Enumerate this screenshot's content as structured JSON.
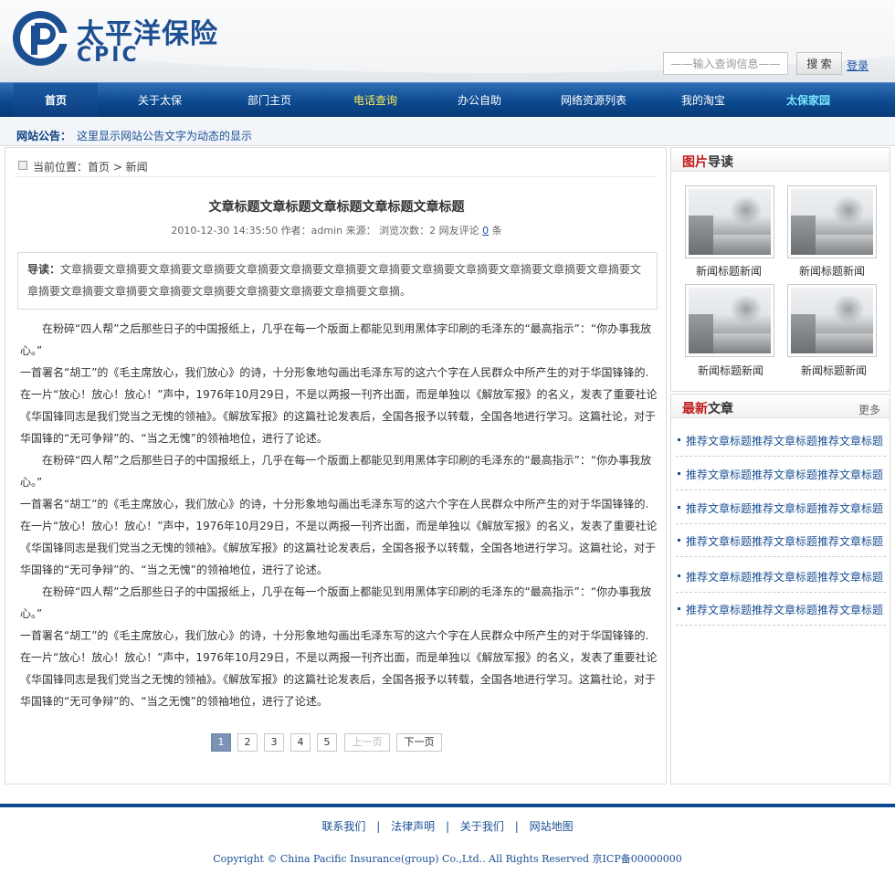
{
  "brand": {
    "name_cn": "太平洋保险",
    "name_en": "CPIC",
    "color": "#1d4f93"
  },
  "search": {
    "placeholder": "——输入查询信息——",
    "button": "搜 索",
    "login": "登录"
  },
  "nav": {
    "items": [
      {
        "label": "首页",
        "style": "active"
      },
      {
        "label": "关于太保",
        "style": ""
      },
      {
        "label": "部门主页",
        "style": ""
      },
      {
        "label": "电话查询",
        "style": "hl-yellow"
      },
      {
        "label": "办公自助",
        "style": ""
      },
      {
        "label": "网络资源列表",
        "style": ""
      },
      {
        "label": "我的淘宝",
        "style": ""
      },
      {
        "label": "太保家园",
        "style": "hl-cyan"
      }
    ]
  },
  "notice": {
    "label": "网站公告：",
    "text": "这里显示网站公告文字为动态的显示"
  },
  "breadcrumb": {
    "text": "当前位置：首页 > 新闻"
  },
  "article": {
    "title": "文章标题文章标题文章标题文章标题文章标题",
    "meta_prefix": "2010-12-30 14:35:50 作者：admin 来源： 浏览次数：2 网友评论",
    "comment_count": "0",
    "meta_suffix": "条",
    "abstract_label": "导读：",
    "abstract_text": "文章摘要文章摘要文章摘要文章摘要文章摘要文章摘要文章摘要文章摘要文章摘要文章摘要文章摘要文章摘要文章摘要文章摘要文章摘要文章摘要文章摘要文章摘要文章摘要文章摘要文章摘要文章摘。",
    "paragraphs": [
      {
        "text": "在粉碎“四人帮”之后那些日子的中国报纸上，几乎在每一个版面上都能见到用黑体字印刷的毛泽东的“最高指示”：“你办事我放心。”",
        "indent": true
      },
      {
        "text": "一首署名“胡工”的《毛主席放心，我们放心》的诗，十分形象地勾画出毛泽东写的这六个字在人民群众中所产生的对于华国锋锋的.在一片“放心！放心！放心！”声中，1976年10月29日，不是以两报一刊齐出面，而是单独以《解放军报》的名义，发表了重要社论《华国锋同志是我们党当之无愧的领袖》。《解放军报》的这篇社论发表后，全国各报予以转载，全国各地进行学习。这篇社论，对于华国锋的“无可争辩”的、“当之无愧”的领袖地位，进行了论述。",
        "indent": false
      },
      {
        "text": "在粉碎“四人帮”之后那些日子的中国报纸上，几乎在每一个版面上都能见到用黑体字印刷的毛泽东的“最高指示”：“你办事我放心。”",
        "indent": true
      },
      {
        "text": "一首署名“胡工”的《毛主席放心，我们放心》的诗，十分形象地勾画出毛泽东写的这六个字在人民群众中所产生的对于华国锋锋的.在一片“放心！放心！放心！”声中，1976年10月29日，不是以两报一刊齐出面，而是单独以《解放军报》的名义，发表了重要社论《华国锋同志是我们党当之无愧的领袖》。《解放军报》的这篇社论发表后，全国各报予以转载，全国各地进行学习。这篇社论，对于华国锋的“无可争辩”的、“当之无愧”的领袖地位，进行了论述。",
        "indent": false
      },
      {
        "text": "在粉碎“四人帮”之后那些日子的中国报纸上，几乎在每一个版面上都能见到用黑体字印刷的毛泽东的“最高指示”：“你办事我放心。”",
        "indent": true
      },
      {
        "text": "一首署名“胡工”的《毛主席放心，我们放心》的诗，十分形象地勾画出毛泽东写的这六个字在人民群众中所产生的对于华国锋锋的.在一片“放心！放心！放心！”声中，1976年10月29日，不是以两报一刊齐出面，而是单独以《解放军报》的名义，发表了重要社论《华国锋同志是我们党当之无愧的领袖》。《解放军报》的这篇社论发表后，全国各报予以转载，全国各地进行学习。这篇社论，对于华国锋的“无可争辩”的、“当之无愧”的领袖地位，进行了论述。",
        "indent": false
      }
    ]
  },
  "pager": {
    "pages": [
      "1",
      "2",
      "3",
      "4",
      "5"
    ],
    "current": "1",
    "prev": "上一页",
    "next": "下一页"
  },
  "picture_guide": {
    "title_red": "图片",
    "title_rest": "导读",
    "items": [
      {
        "caption": "新闻标题新闻"
      },
      {
        "caption": "新闻标题新闻"
      },
      {
        "caption": "新闻标题新闻"
      },
      {
        "caption": "新闻标题新闻"
      }
    ]
  },
  "latest": {
    "title_red": "最新",
    "title_rest": "文章",
    "more": "更多",
    "items": [
      "推荐文章标题推荐文章标题推荐文章标题",
      "推荐文章标题推荐文章标题推荐文章标题",
      "推荐文章标题推荐文章标题推荐文章标题",
      "推荐文章标题推荐文章标题推荐文章标题",
      "推荐文章标题推荐文章标题推荐文章标题",
      "推荐文章标题推荐文章标题推荐文章标题"
    ]
  },
  "footer": {
    "links": [
      "联系我们",
      "法律声明",
      "关于我们",
      "网站地图"
    ],
    "sep1": "|",
    "sep2": "|",
    "sep3": "|",
    "copyright": "Copyright © China Pacific Insurance(group) Co.,Ltd.. All Rights Reserved 京ICP备00000000"
  }
}
